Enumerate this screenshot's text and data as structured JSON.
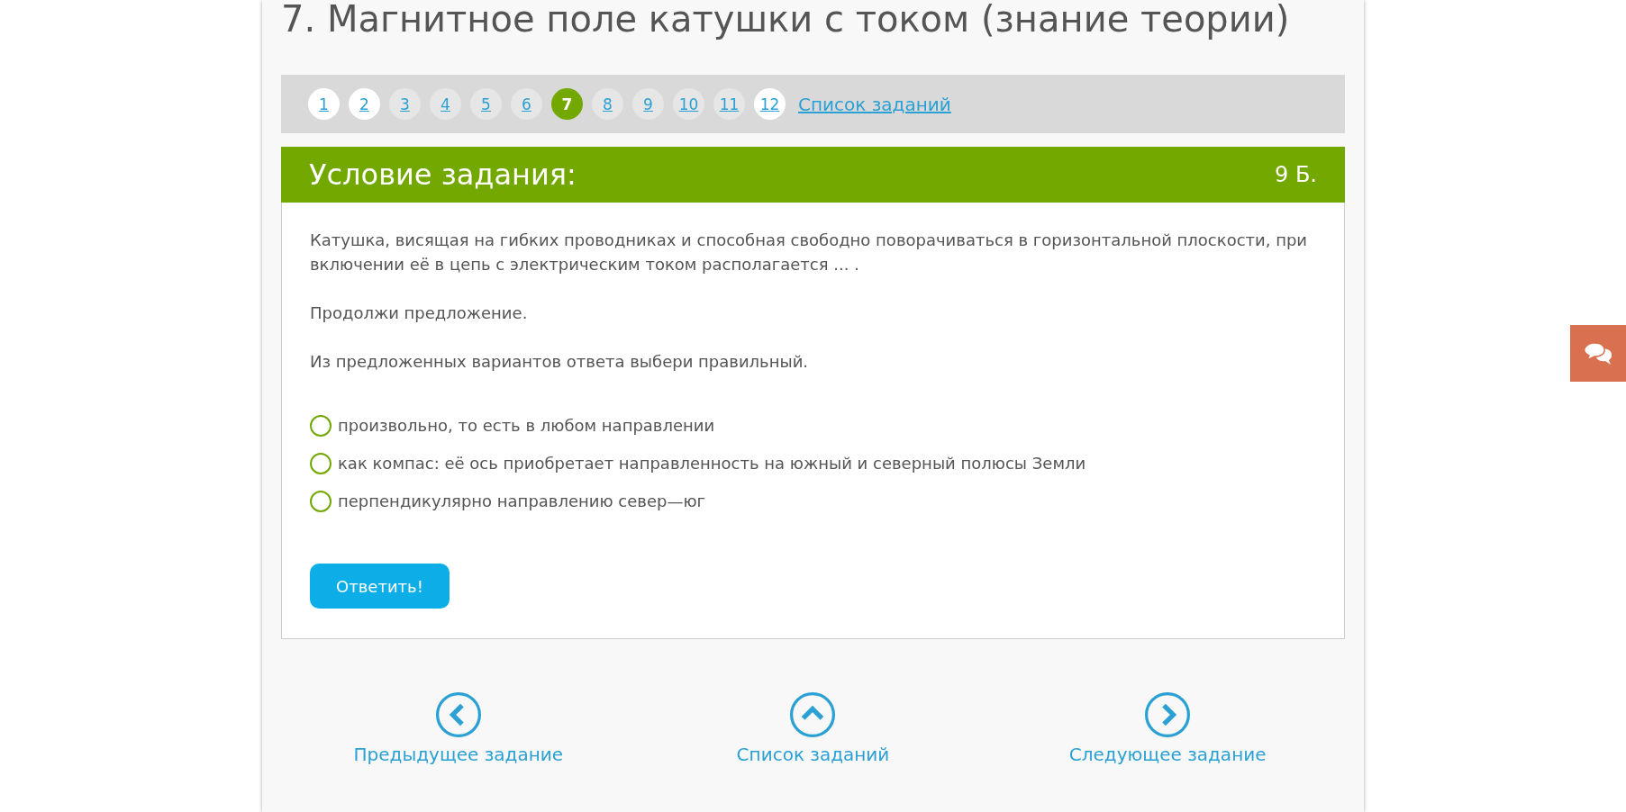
{
  "title": "7. Магнитное поле катушки с током (знание теории)",
  "pagination": {
    "pages": [
      {
        "label": "1",
        "selected": false,
        "visited": true
      },
      {
        "label": "2",
        "selected": false,
        "visited": true
      },
      {
        "label": "3",
        "selected": false,
        "visited": false
      },
      {
        "label": "4",
        "selected": false,
        "visited": false
      },
      {
        "label": "5",
        "selected": false,
        "visited": false
      },
      {
        "label": "6",
        "selected": false,
        "visited": false
      },
      {
        "label": "7",
        "selected": true,
        "visited": false
      },
      {
        "label": "8",
        "selected": false,
        "visited": false
      },
      {
        "label": "9",
        "selected": false,
        "visited": false
      },
      {
        "label": "10",
        "selected": false,
        "visited": false
      },
      {
        "label": "11",
        "selected": false,
        "visited": false
      },
      {
        "label": "12",
        "selected": false,
        "visited": true
      }
    ],
    "list_link": "Список заданий"
  },
  "task": {
    "heading": "Условие задания:",
    "points": "9 Б.",
    "paragraphs": [
      "Катушка, висящая на гибких проводниках и способная свободно поворачиваться в горизонтальной плоскости, при включении её в цепь с электрическим током располагается ... .",
      "Продолжи предложение.",
      "Из предложенных вариантов ответа выбери правильный."
    ],
    "options": [
      {
        "label": "произвольно, то есть в любом направлении",
        "selected": false
      },
      {
        "label": "как компас: её ось приобретает направленность на южный и северный полюсы Земли",
        "selected": false
      },
      {
        "label": "перпендикулярно направлению север—юг",
        "selected": false
      }
    ],
    "submit": "Ответить!"
  },
  "navigation": [
    {
      "kind": "prev",
      "label": "Предыдущее задание"
    },
    {
      "kind": "list",
      "label": "Список заданий"
    },
    {
      "kind": "next",
      "label": "Следующее задание"
    }
  ]
}
